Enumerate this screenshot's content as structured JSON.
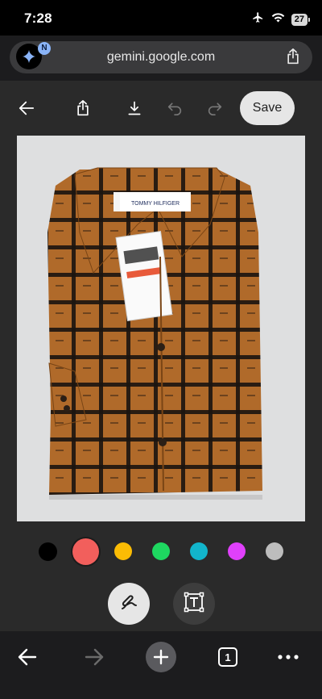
{
  "status_bar": {
    "time": "7:28",
    "battery": "27"
  },
  "browser": {
    "url": "gemini.google.com",
    "site_badge": "N"
  },
  "editor": {
    "save_label": "Save",
    "photo": {
      "label_text": "TOMMY HILFIGER"
    },
    "palette": [
      {
        "name": "black",
        "color": "#000000"
      },
      {
        "name": "red",
        "color": "#f25f5c"
      },
      {
        "name": "yellow",
        "color": "#fbbc04"
      },
      {
        "name": "green",
        "color": "#1ed760"
      },
      {
        "name": "cyan",
        "color": "#12b5cb"
      },
      {
        "name": "magenta",
        "color": "#e040fb"
      },
      {
        "name": "gray",
        "color": "#bdbdbd"
      }
    ],
    "selected_color": "red",
    "tools": [
      {
        "name": "pen",
        "active": true
      },
      {
        "name": "text",
        "active": false
      }
    ]
  },
  "bottom_nav": {
    "tab_count": "1"
  },
  "colors": {
    "background": "#2a2a2a",
    "chrome": "#1c1c1e",
    "shirt": "#b06a2a",
    "check": "#1b1410"
  }
}
